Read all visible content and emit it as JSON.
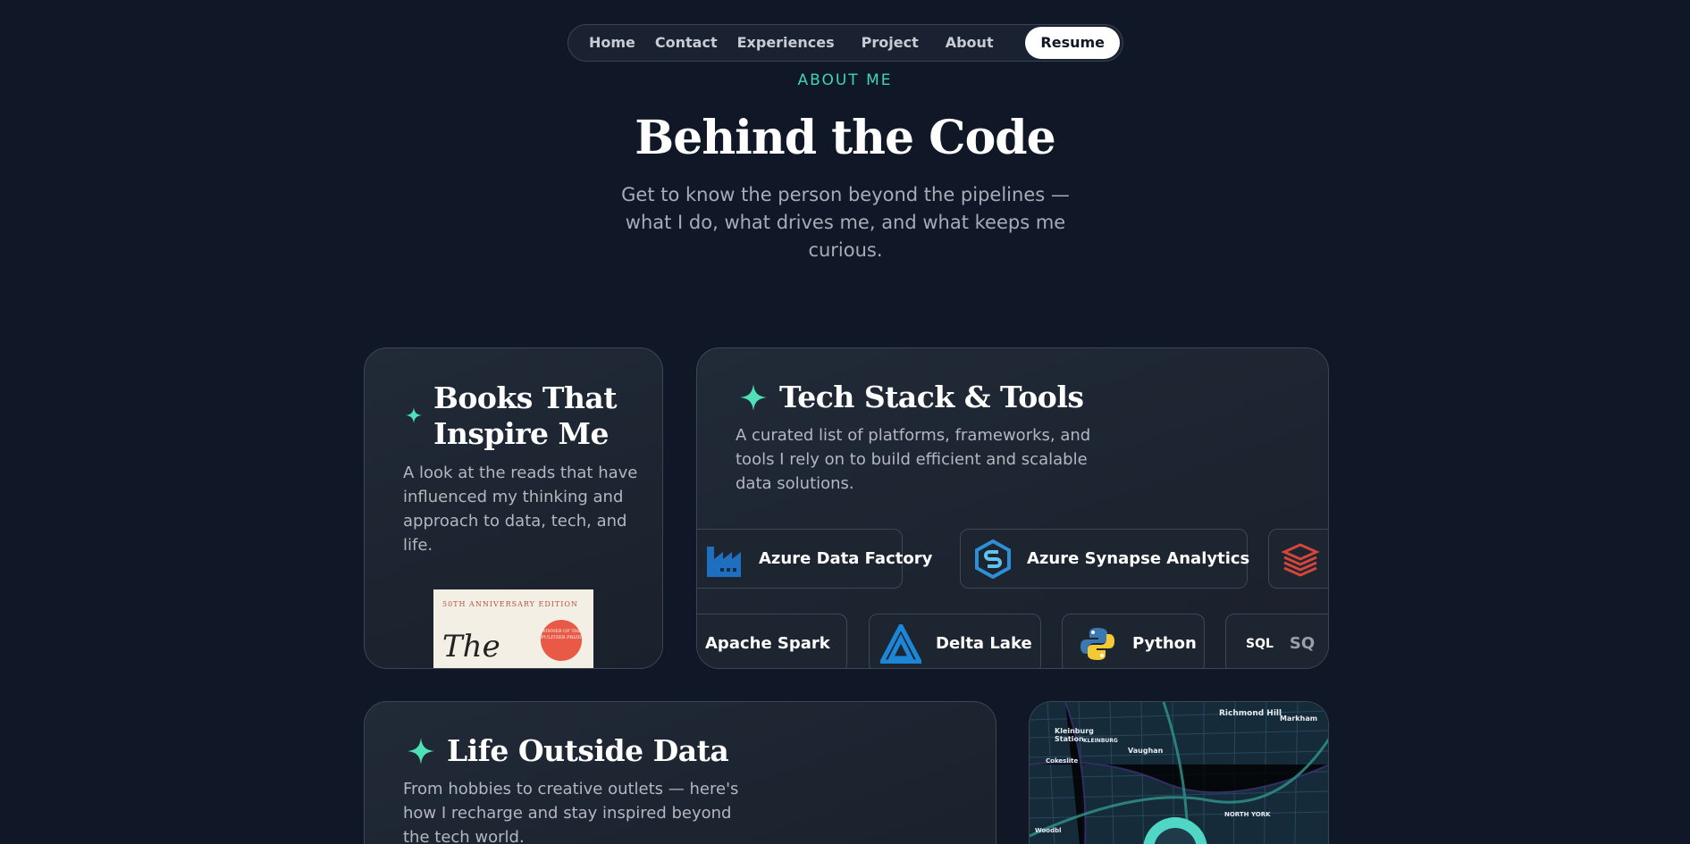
{
  "nav": {
    "items": [
      {
        "label": "Home"
      },
      {
        "label": "Contact"
      },
      {
        "label": "Experiences"
      },
      {
        "label": "Project"
      },
      {
        "label": "About"
      }
    ],
    "resume_label": "Resume"
  },
  "hero": {
    "eyebrow": "ABOUT ME",
    "title": "Behind the Code",
    "subtitle": "Get to know the person beyond the pipelines — what I do, what drives me, and what keeps me curious."
  },
  "colors": {
    "background": "#101726",
    "accent": "#3fd6b3",
    "card": "#1f2733"
  },
  "books": {
    "title": "Books That Inspire Me",
    "description": "A look at the reads that have influenced my thinking and approach to data, tech, and life.",
    "cover": {
      "edition": "50TH ANNIVERSARY EDITION",
      "badge": "WINNER OF THE PULITZER PRIZE",
      "title_fragment": "The"
    }
  },
  "tech": {
    "title": "Tech Stack & Tools",
    "description": "A curated list of platforms, frameworks, and tools I rely on to build efficient and scalable data solutions.",
    "row1": [
      {
        "label": "Azure Data Factory",
        "icon": "factory-icon"
      },
      {
        "label": "Azure Synapse Analytics",
        "icon": "synapse-icon"
      },
      {
        "label": "",
        "icon": "databricks-icon"
      }
    ],
    "row2": [
      {
        "label": "Apache Spark",
        "icon": "spark-icon"
      },
      {
        "label": "Delta Lake",
        "icon": "delta-icon"
      },
      {
        "label": "Python",
        "icon": "python-icon"
      },
      {
        "label": "SQ",
        "icon": "sql-icon",
        "icon_text": "SQL"
      }
    ]
  },
  "life": {
    "title": "Life Outside Data",
    "description": "From hobbies to creative outlets — here's how I recharge and stay inspired beyond the tech world."
  },
  "map": {
    "labels": [
      "Richmond Hill",
      "Markham",
      "Kleinburg Station",
      "KLEINBURG",
      "Vaughan",
      "Cokeslite",
      "NORTH YORK",
      "Woodbl"
    ]
  }
}
